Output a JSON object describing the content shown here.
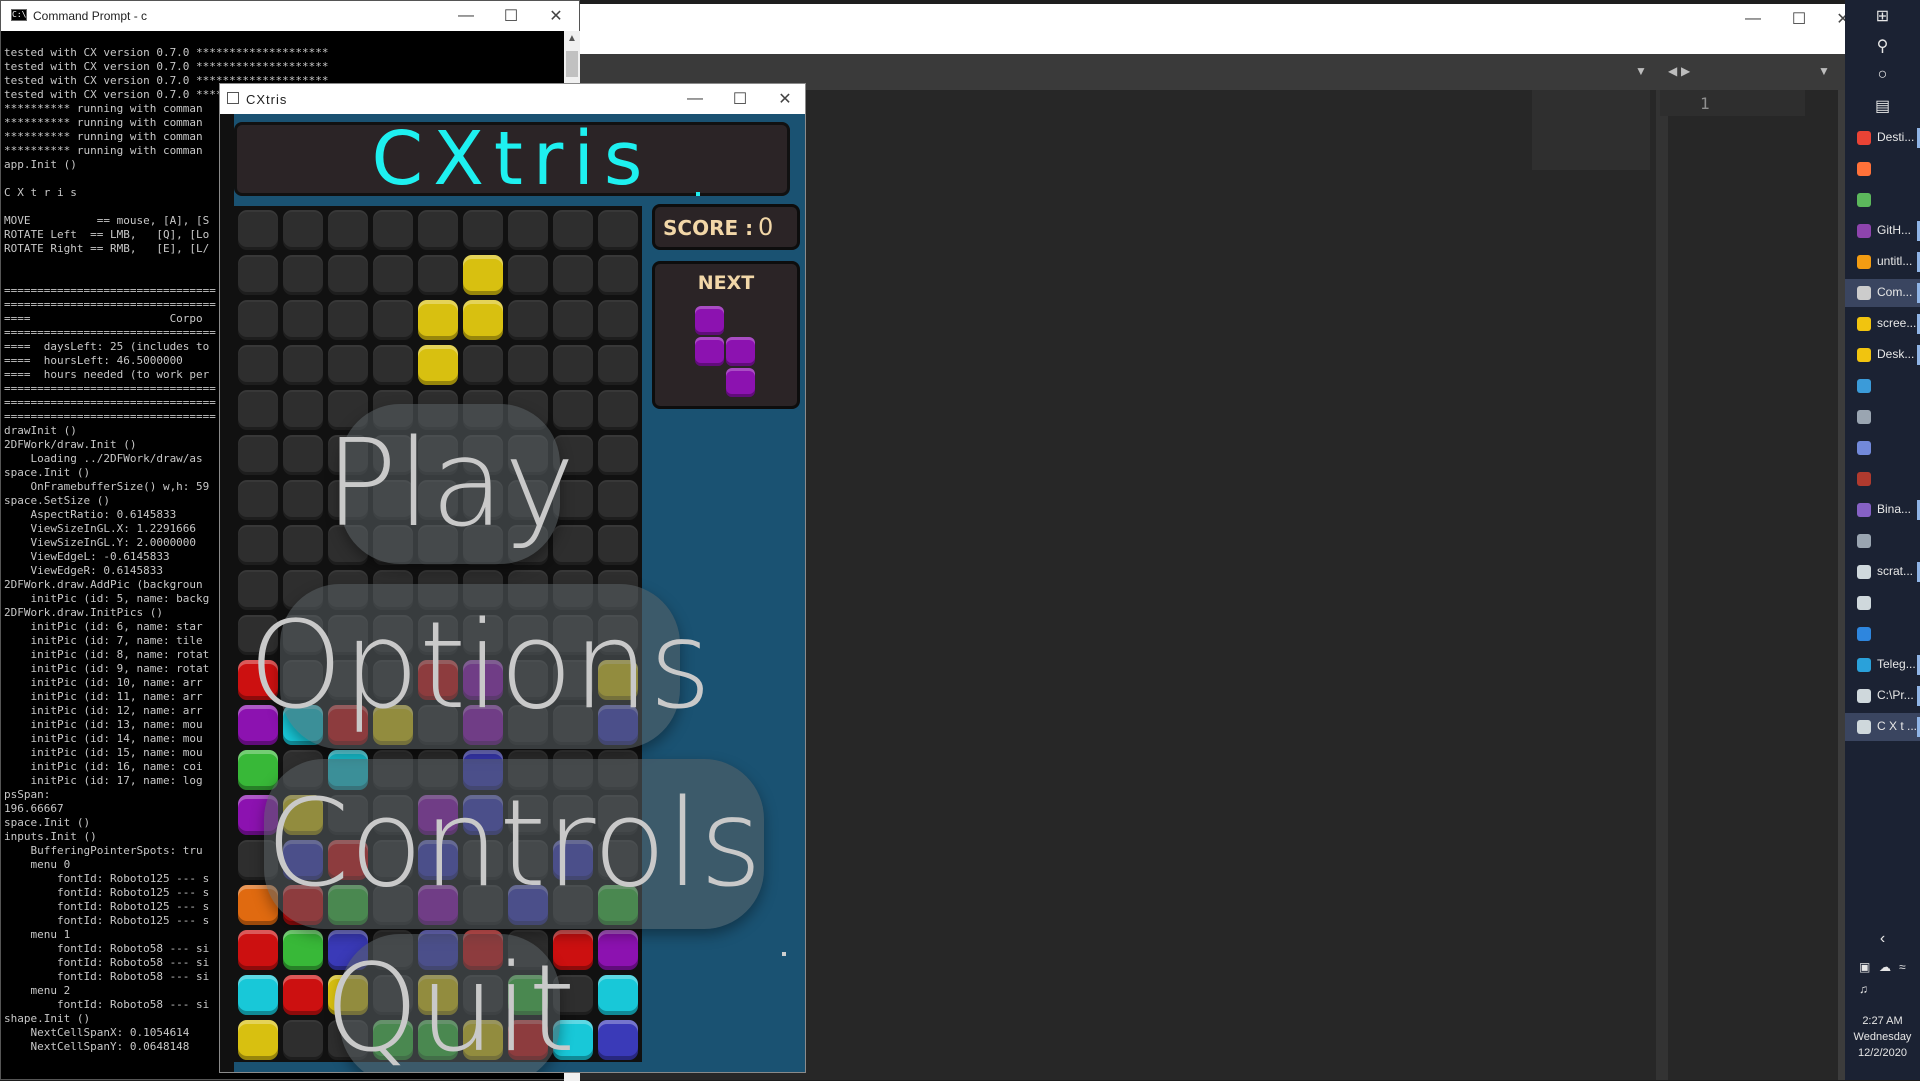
{
  "cmd": {
    "title": "Command Prompt - c",
    "lines": [
      "tested with CX version 0.7.0 ********************",
      "tested with CX version 0.7.0 ********************",
      "tested with CX version 0.7.0 ********************",
      "tested with CX version 0.7.0 ******",
      "********** running with comman",
      "********** running with comman",
      "********** running with comman",
      "********** running with comman",
      "app.Init ()",
      "",
      "C X t r i s",
      "",
      "MOVE          == mouse, [A], [S",
      "ROTATE Left  == LMB,   [Q], [Lo",
      "ROTATE Right == RMB,   [E], [L/",
      "",
      "",
      "================================",
      "================================",
      "====                     Corpo",
      "================================",
      "====  daysLeft: 25 (includes to",
      "====  hoursLeft: 46.5000000",
      "====  hours needed (to work per",
      "================================",
      "================================",
      "================================",
      "drawInit ()",
      "2DFWork/draw.Init ()",
      "    Loading ../2DFWork/draw/as",
      "space.Init ()",
      "    OnFramebufferSize() w,h: 59",
      "space.SetSize ()",
      "    AspectRatio: 0.6145833",
      "    ViewSizeInGL.X: 1.2291666",
      "    ViewSizeInGL.Y: 2.0000000",
      "    ViewEdgeL: -0.6145833",
      "    ViewEdgeR: 0.6145833",
      "2DFWork.draw.AddPic (backgroun",
      "    initPic (id: 5, name: backg",
      "2DFWork.draw.InitPics ()",
      "    initPic (id: 6, name: star",
      "    initPic (id: 7, name: tile",
      "    initPic (id: 8, name: rotat",
      "    initPic (id: 9, name: rotat",
      "    initPic (id: 10, name: arr",
      "    initPic (id: 11, name: arr",
      "    initPic (id: 12, name: arr",
      "    initPic (id: 13, name: mou",
      "    initPic (id: 14, name: mou",
      "    initPic (id: 15, name: mou",
      "    initPic (id: 16, name: coi",
      "    initPic (id: 17, name: log",
      "psSpan:",
      "196.66667",
      "space.Init ()",
      "inputs.Init ()",
      "    BufferingPointerSpots: tru",
      "    menu 0",
      "        fontId: Roboto125 --- s",
      "        fontId: Roboto125 --- s",
      "        fontId: Roboto125 --- s",
      "        fontId: Roboto125 --- s",
      "    menu 1",
      "        fontId: Roboto58 --- si",
      "        fontId: Roboto58 --- si",
      "        fontId: Roboto58 --- si",
      "    menu 2",
      "        fontId: Roboto58 --- si",
      "shape.Init ()",
      "    NextCellSpanX: 0.1054614",
      "    NextCellSpanY: 0.0648148"
    ]
  },
  "editor": {
    "line_number": "1"
  },
  "game": {
    "title": "CXtris",
    "logo": "CXtris",
    "score_label": "SCORE :",
    "score_value": "0",
    "next_label": "NEXT",
    "menu": {
      "play": "Play",
      "options": "Options",
      "controls": "Controls",
      "quit": "Quit"
    },
    "colors": {
      "empty": "#2e2e2e",
      "yellow": "#d8c010",
      "red": "#cc1010",
      "purple": "#8c12b0",
      "cyan": "#18c8d8",
      "green": "#38b838",
      "orange": "#e06a10",
      "blue": "#3a3ab8"
    },
    "board": [
      [
        ".",
        ".",
        ".",
        ".",
        ".",
        ".",
        ".",
        ".",
        "."
      ],
      [
        ".",
        ".",
        ".",
        ".",
        ".",
        "Y",
        ".",
        ".",
        "."
      ],
      [
        ".",
        ".",
        ".",
        ".",
        "Y",
        "Y",
        ".",
        ".",
        "."
      ],
      [
        ".",
        ".",
        ".",
        ".",
        "Y",
        ".",
        ".",
        ".",
        "."
      ],
      [
        ".",
        ".",
        ".",
        ".",
        ".",
        ".",
        ".",
        ".",
        "."
      ],
      [
        ".",
        ".",
        ".",
        ".",
        ".",
        ".",
        ".",
        ".",
        "."
      ],
      [
        ".",
        ".",
        ".",
        ".",
        ".",
        ".",
        ".",
        ".",
        "."
      ],
      [
        ".",
        ".",
        ".",
        ".",
        ".",
        ".",
        ".",
        ".",
        "."
      ],
      [
        ".",
        ".",
        ".",
        ".",
        ".",
        ".",
        ".",
        ".",
        "."
      ],
      [
        ".",
        ".",
        ".",
        ".",
        ".",
        ".",
        ".",
        ".",
        "."
      ],
      [
        "R",
        ".",
        ".",
        ".",
        "R",
        "P",
        ".",
        ".",
        "Y"
      ],
      [
        "P",
        "C",
        "R",
        "Y",
        ".",
        "P",
        ".",
        ".",
        "B"
      ],
      [
        "G",
        ".",
        "C",
        ".",
        ".",
        "B",
        ".",
        ".",
        "."
      ],
      [
        "P",
        "Y",
        ".",
        ".",
        "P",
        "B",
        ".",
        ".",
        "."
      ],
      [
        ".",
        "B",
        "R",
        ".",
        "B",
        ".",
        ".",
        "B",
        "."
      ],
      [
        "O",
        "R",
        "G",
        ".",
        "P",
        ".",
        "B",
        ".",
        "G"
      ],
      [
        "R",
        "G",
        "B",
        ".",
        "B",
        "R",
        ".",
        "R",
        "P"
      ],
      [
        "C",
        "R",
        "Y",
        ".",
        "Y",
        ".",
        "G",
        ".",
        "C"
      ],
      [
        "Y",
        ".",
        ".",
        "G",
        "G",
        "Y",
        "R",
        "C",
        "B"
      ]
    ],
    "next_piece": [
      [
        0,
        0
      ],
      [
        0,
        1
      ],
      [
        1,
        1
      ],
      [
        1,
        2
      ]
    ]
  },
  "taskbar": {
    "items": [
      {
        "label": "Desti...",
        "color": "#ea4335",
        "active": false
      },
      {
        "label": "",
        "color": "#ff7139",
        "active": false
      },
      {
        "label": "",
        "color": "#5cb85c",
        "active": false
      },
      {
        "label": "GitH...",
        "color": "#8e44ad",
        "active": false
      },
      {
        "label": "untitl...",
        "color": "#f39c12",
        "active": false
      },
      {
        "label": "Com...",
        "color": "#cccccc",
        "active": true
      },
      {
        "label": "scree...",
        "color": "#f1c40f",
        "active": false
      },
      {
        "label": "Desk...",
        "color": "#f1c40f",
        "active": false
      },
      {
        "label": "",
        "color": "#3b9bd9",
        "active": false
      },
      {
        "label": "",
        "color": "#9aa5b1",
        "active": false
      },
      {
        "label": "",
        "color": "#7289da",
        "active": false
      },
      {
        "label": "",
        "color": "#b03a2e",
        "active": false
      },
      {
        "label": "Bina...",
        "color": "#8661c5",
        "active": false
      },
      {
        "label": "",
        "color": "#9aa5b1",
        "active": false
      },
      {
        "label": "scrat...",
        "color": "#cfd8dc",
        "active": false
      },
      {
        "label": "",
        "color": "#cfd8dc",
        "active": false
      },
      {
        "label": "",
        "color": "#2e86de",
        "active": false
      },
      {
        "label": "Teleg...",
        "color": "#2aa1da",
        "active": false
      },
      {
        "label": "C:\\Pr...",
        "color": "#cfd8dc",
        "active": false
      },
      {
        "label": "C X t ...",
        "color": "#cfd8dc",
        "active": true
      }
    ],
    "time": "2:27 AM",
    "day": "Wednesday",
    "date": "12/2/2020"
  }
}
